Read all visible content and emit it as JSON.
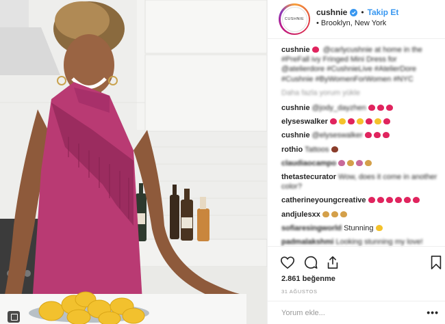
{
  "post": {
    "username": "cushnie",
    "avatar_text": "CUSHNIE",
    "follow_label": "Takip Et",
    "separator": "•",
    "location": "Brooklyn, New York",
    "verified": true
  },
  "caption": {
    "username": "cushnie",
    "text": "@carlycushnie at home in the #PreFall ivy Fringed Mini Dress for @atelierdore #CushnieLive #AtelierDore #Cushnie #ByWomenForWomen #NYC"
  },
  "load_more_label": "Daha fazla yorum yükle",
  "comments": [
    {
      "user": "cushnie",
      "text": "@jody_dayzhen"
    },
    {
      "user": "elyseswalker",
      "text": ""
    },
    {
      "user": "cushnie",
      "text": "@elyseswalker"
    },
    {
      "user": "rothio",
      "text": "Tattoos"
    },
    {
      "user": "claudiaocampo",
      "text": ""
    },
    {
      "user": "thetastecurator",
      "text": "Wow, does it come in another color?"
    },
    {
      "user": "catherineyoungcreative",
      "text": ""
    },
    {
      "user": "andjulesxx",
      "text": ""
    },
    {
      "user": "sofiaresingworld",
      "text": "Stunning"
    },
    {
      "user": "padmalakshmi",
      "text": "Looking stunning my love!"
    }
  ],
  "actions": {
    "like_icon": "heart-icon",
    "comment_icon": "comment-bubble-icon",
    "share_icon": "share-icon",
    "save_icon": "bookmark-icon"
  },
  "likes_text": "2.861 beğenme",
  "date_text": "31 AĞUSTOS",
  "comment_placeholder": "Yorum ekle...",
  "more_label": "•••",
  "colors": {
    "accent": "#3897f0",
    "dress": "#b93a73",
    "text": "#262626",
    "muted": "#999999"
  }
}
